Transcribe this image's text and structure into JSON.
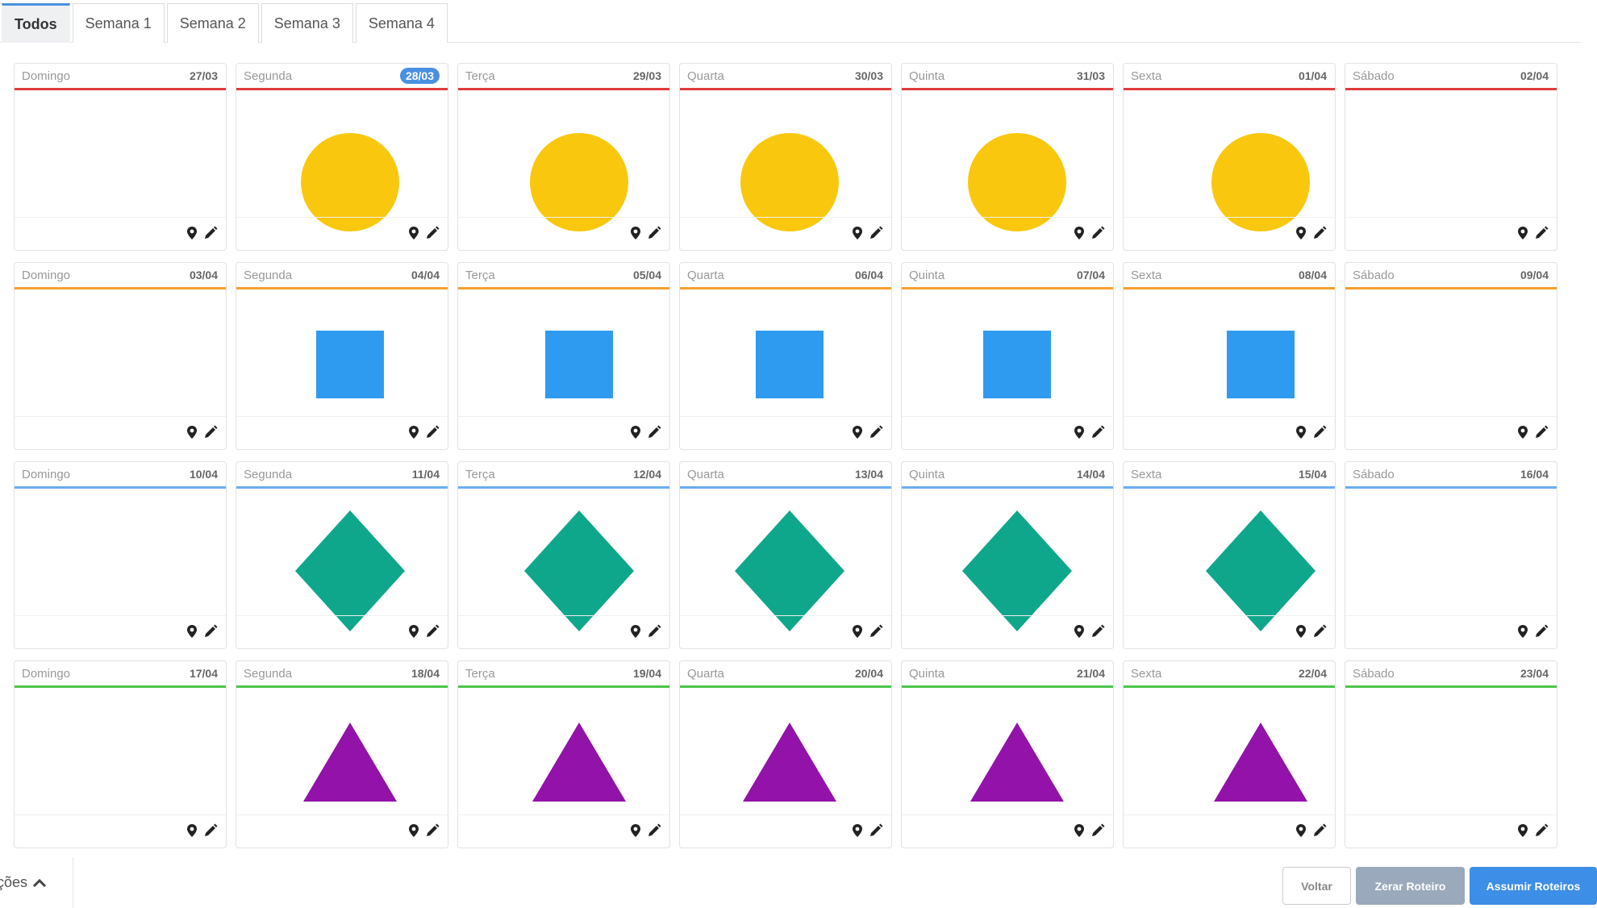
{
  "tabs": [
    "Todos",
    "Semana 1",
    "Semana 2",
    "Semana 3",
    "Semana 4"
  ],
  "active_tab": 0,
  "weeks": [
    {
      "color": "#e03c3c",
      "shape": "circle",
      "shape_color": "#f9c80e",
      "days": [
        {
          "name": "Domingo",
          "date": "27/03"
        },
        {
          "name": "Segunda",
          "date": "28/03",
          "today": true
        },
        {
          "name": "Terça",
          "date": "29/03"
        },
        {
          "name": "Quarta",
          "date": "30/03"
        },
        {
          "name": "Quinta",
          "date": "31/03"
        },
        {
          "name": "Sexta",
          "date": "01/04"
        },
        {
          "name": "Sábado",
          "date": "02/04"
        }
      ]
    },
    {
      "color": "#f5a030",
      "shape": "square",
      "shape_color": "#2f9bf0",
      "days": [
        {
          "name": "Domingo",
          "date": "03/04"
        },
        {
          "name": "Segunda",
          "date": "04/04"
        },
        {
          "name": "Terça",
          "date": "05/04"
        },
        {
          "name": "Quarta",
          "date": "06/04"
        },
        {
          "name": "Quinta",
          "date": "07/04"
        },
        {
          "name": "Sexta",
          "date": "08/04"
        },
        {
          "name": "Sábado",
          "date": "09/04"
        }
      ]
    },
    {
      "color": "#6aaef0",
      "shape": "diamond",
      "shape_color": "#0fa78b",
      "days": [
        {
          "name": "Domingo",
          "date": "10/04"
        },
        {
          "name": "Segunda",
          "date": "11/04"
        },
        {
          "name": "Terça",
          "date": "12/04"
        },
        {
          "name": "Quarta",
          "date": "13/04"
        },
        {
          "name": "Quinta",
          "date": "14/04"
        },
        {
          "name": "Sexta",
          "date": "15/04"
        },
        {
          "name": "Sábado",
          "date": "16/04"
        }
      ]
    },
    {
      "color": "#4cc54c",
      "shape": "triangle",
      "shape_color": "#9212aa",
      "days": [
        {
          "name": "Domingo",
          "date": "17/04"
        },
        {
          "name": "Segunda",
          "date": "18/04"
        },
        {
          "name": "Terça",
          "date": "19/04"
        },
        {
          "name": "Quarta",
          "date": "20/04"
        },
        {
          "name": "Quinta",
          "date": "21/04"
        },
        {
          "name": "Sexta",
          "date": "22/04"
        },
        {
          "name": "Sábado",
          "date": "23/04"
        }
      ]
    }
  ],
  "card_icons": [
    "map-pin-icon",
    "pencil-icon"
  ],
  "footer": {
    "options_label": "ções",
    "options_icon": "chevron-up-icon",
    "back_label": "Voltar",
    "reset_label": "Zerar Roteiro",
    "assume_label": "Assumir Roteiros"
  }
}
